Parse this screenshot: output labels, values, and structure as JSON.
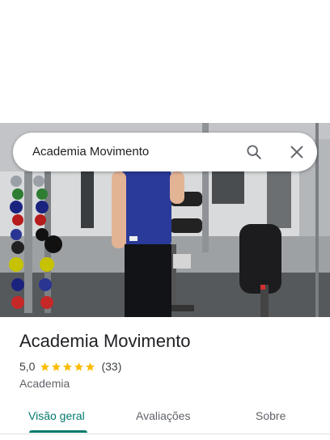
{
  "search": {
    "query": "Academia Movimento",
    "search_icon": "search-icon",
    "close_icon": "close-icon"
  },
  "place": {
    "title": "Academia Movimento",
    "rating": "5,0",
    "stars": 5,
    "review_count": "(33)",
    "category": "Academia"
  },
  "tabs": [
    {
      "label": "Visão geral",
      "active": true
    },
    {
      "label": "Avaliações",
      "active": false
    },
    {
      "label": "Sobre",
      "active": false
    }
  ],
  "colors": {
    "accent": "#00796b",
    "star": "#fbbc04",
    "title": "#202124",
    "muted": "#5f6368"
  }
}
